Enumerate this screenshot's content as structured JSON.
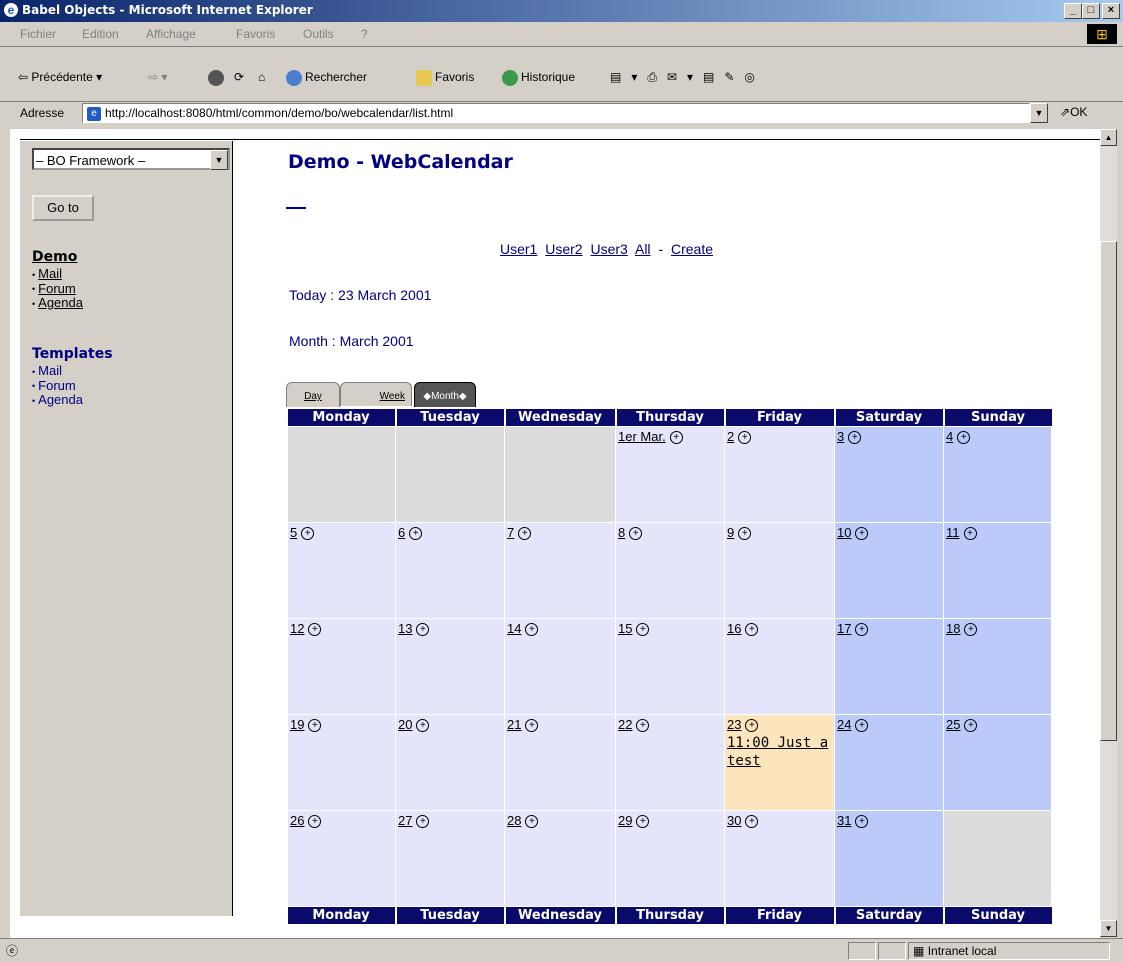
{
  "window": {
    "title": "Babel Objects - Microsoft Internet Explorer",
    "buttons": [
      "_",
      "□",
      "×"
    ]
  },
  "menu": {
    "items": [
      "Fichier",
      "Edition",
      "Affichage",
      "Favoris",
      "Outils",
      "?"
    ]
  },
  "toolbar": {
    "back": "⇦ Précédente",
    "search": "Rechercher",
    "favorites": "Favoris",
    "history": "Historique"
  },
  "address": {
    "label": "Adresse",
    "url": "http://localhost:8080/html/common/demo/bo/webcalendar/list.html",
    "go": "OK"
  },
  "sidebar": {
    "select_value": "– BO Framework –",
    "goto_label": "Go to",
    "demo_title": "Demo",
    "demo_items": [
      "Mail",
      "Forum",
      "Agenda"
    ],
    "templates_title": "Templates",
    "template_items": [
      "Mail",
      "Forum",
      "Agenda"
    ]
  },
  "main": {
    "title": "Demo - WebCalendar",
    "nav": {
      "users": [
        "User1",
        "User2",
        "User3",
        "All"
      ],
      "separator": "-",
      "create": "Create"
    },
    "today": "Today : 23 March 2001",
    "month": "Month : March 2001",
    "tabs": [
      "Day",
      "Week",
      "Month"
    ]
  },
  "calendar": {
    "weekdays": [
      "Monday",
      "Tuesday",
      "Wednesday",
      "Thursday",
      "Friday",
      "Saturday",
      "Sunday"
    ],
    "weeks": [
      [
        "",
        "",
        "",
        "1er Mar.",
        "2",
        "3",
        "4"
      ],
      [
        "5",
        "6",
        "7",
        "8",
        "9",
        "10",
        "11"
      ],
      [
        "12",
        "13",
        "14",
        "15",
        "16",
        "17",
        "18"
      ],
      [
        "19",
        "20",
        "21",
        "22",
        "23",
        "24",
        "25"
      ],
      [
        "26",
        "27",
        "28",
        "29",
        "30",
        "31",
        ""
      ]
    ],
    "event": {
      "day": "23",
      "text": "11:00 Just a test"
    },
    "colors": {
      "header": "#0a0a6b",
      "weekday": "#e4e4fa",
      "weekend": "#bccafa",
      "empty": "#dcdcdc",
      "today": "#fce4bc"
    }
  },
  "status": {
    "zone": "Intranet local"
  }
}
